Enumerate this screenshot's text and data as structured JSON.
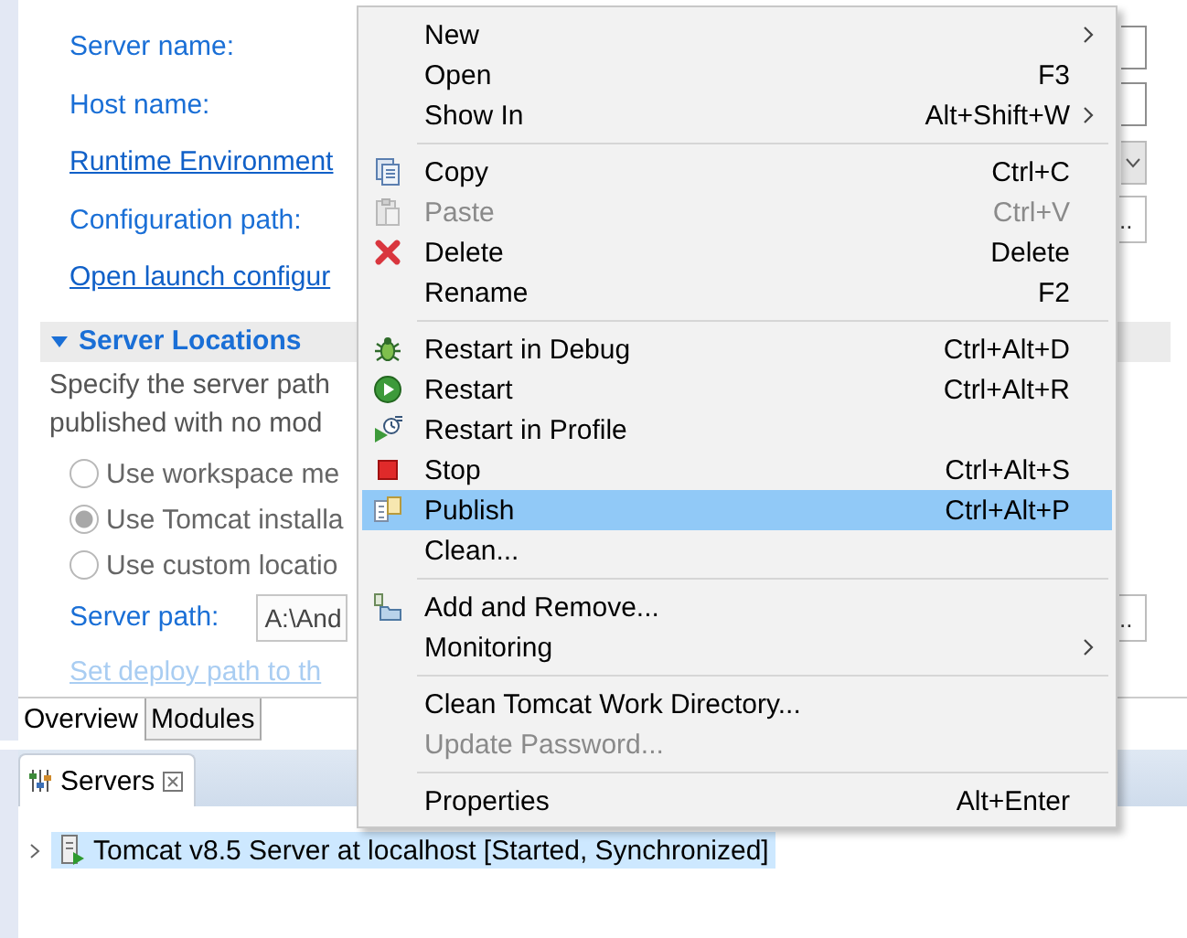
{
  "editor": {
    "general_rows": [
      {
        "kind": "label",
        "label": "Server name:"
      },
      {
        "kind": "label",
        "label": "Host name:"
      },
      {
        "kind": "link",
        "label": "Runtime Environment"
      },
      {
        "kind": "label",
        "label": "Configuration path:",
        "browse_label": ".."
      },
      {
        "kind": "link",
        "label": "Open launch configur"
      }
    ],
    "server_locations": {
      "title": "Server Locations",
      "expanded": true,
      "description": [
        "Specify the server path",
        "published with no mod"
      ],
      "options": [
        {
          "label": "Use workspace me",
          "selected": false,
          "disabled": true
        },
        {
          "label": "Use Tomcat installa",
          "selected": true,
          "disabled": true
        },
        {
          "label": "Use custom locatio",
          "selected": false,
          "disabled": true
        }
      ],
      "server_path": {
        "label": "Server path:",
        "value": "A:\\And",
        "browse_label": ".."
      },
      "deploy_link": {
        "label": "Set deploy path to th",
        "disabled": true
      }
    },
    "tabs": [
      {
        "label": "Overview",
        "selected": true
      },
      {
        "label": "Modules",
        "selected": false
      }
    ]
  },
  "servers_view": {
    "tab": {
      "label": "Servers"
    },
    "tree": [
      {
        "label": "Tomcat v8.5 Server at localhost  [Started, Synchronized]",
        "expanded": false,
        "selected": true
      }
    ]
  },
  "context_menu": {
    "items": [
      {
        "kind": "item",
        "label": "New",
        "submenu": true,
        "selected": false,
        "disabled": false
      },
      {
        "kind": "item",
        "label": "Open",
        "shortcut": "F3",
        "selected": false,
        "disabled": false
      },
      {
        "kind": "item",
        "label": "Show In",
        "shortcut": "Alt+Shift+W",
        "submenu": true,
        "selected": false,
        "disabled": false
      },
      {
        "kind": "separator"
      },
      {
        "kind": "item",
        "label": "Copy",
        "shortcut": "Ctrl+C",
        "selected": false,
        "disabled": false
      },
      {
        "kind": "item",
        "label": "Paste",
        "shortcut": "Ctrl+V",
        "selected": false,
        "disabled": true
      },
      {
        "kind": "item",
        "label": "Delete",
        "shortcut": "Delete",
        "selected": false,
        "disabled": false
      },
      {
        "kind": "item",
        "label": "Rename",
        "shortcut": "F2",
        "selected": false,
        "disabled": false
      },
      {
        "kind": "separator"
      },
      {
        "kind": "item",
        "label": "Restart in Debug",
        "shortcut": "Ctrl+Alt+D",
        "selected": false,
        "disabled": false
      },
      {
        "kind": "item",
        "label": "Restart",
        "shortcut": "Ctrl+Alt+R",
        "selected": false,
        "disabled": false
      },
      {
        "kind": "item",
        "label": "Restart in Profile",
        "selected": false,
        "disabled": false
      },
      {
        "kind": "item",
        "label": "Stop",
        "shortcut": "Ctrl+Alt+S",
        "selected": false,
        "disabled": false
      },
      {
        "kind": "item",
        "label": "Publish",
        "shortcut": "Ctrl+Alt+P",
        "selected": true,
        "disabled": false
      },
      {
        "kind": "item",
        "label": "Clean...",
        "selected": false,
        "disabled": false
      },
      {
        "kind": "separator"
      },
      {
        "kind": "item",
        "label": "Add and Remove...",
        "selected": false,
        "disabled": false
      },
      {
        "kind": "item",
        "label": "Monitoring",
        "submenu": true,
        "selected": false,
        "disabled": false
      },
      {
        "kind": "separator"
      },
      {
        "kind": "item",
        "label": "Clean Tomcat Work Directory...",
        "selected": false,
        "disabled": false
      },
      {
        "kind": "item",
        "label": "Update Password...",
        "selected": false,
        "disabled": true
      },
      {
        "kind": "separator"
      },
      {
        "kind": "item",
        "label": "Properties",
        "shortcut": "Alt+Enter",
        "selected": false,
        "disabled": false
      }
    ]
  }
}
